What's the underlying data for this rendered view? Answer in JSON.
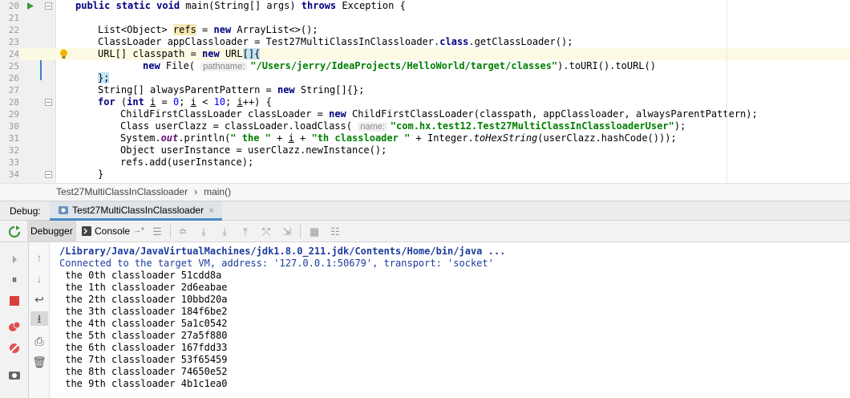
{
  "editor": {
    "line_numbers": [
      "20",
      "21",
      "22",
      "23",
      "24",
      "25",
      "26",
      "27",
      "28",
      "29",
      "30",
      "31",
      "32",
      "33",
      "34"
    ],
    "lines": {
      "l20": {
        "kw1": "public static void ",
        "rest": "main(String[] args) ",
        "kw2": "throws ",
        "rest2": "Exception {"
      },
      "l22": {
        "a": "List<Object> ",
        "refs": "refs",
        "b": " = ",
        "kw": "new ",
        "c": "ArrayList<>();"
      },
      "l23": {
        "a": "ClassLoader appClassloader = Test27MultiClassInClassloader.",
        "kw": "class",
        "b": ".getClassLoader();"
      },
      "l24": {
        "a": "URL[] classpath = ",
        "kw": "new ",
        "b": "URL",
        "brk": "[]{"
      },
      "l25": {
        "kw": "new ",
        "a": "File( ",
        "hint": "pathname:",
        "str": "\"/Users/jerry/IdeaProjects/HelloWorld/target/classes\"",
        "b": ").toURI().toURL()"
      },
      "l26": {
        "brk": "};"
      },
      "l27": {
        "a": "String[] alwaysParentPattern = ",
        "kw": "new ",
        "b": "String[]{};"
      },
      "l28": {
        "kw1": "for ",
        "a": "(",
        "kw2": "int ",
        "i1": "i",
        "b": " = ",
        "n0": "0",
        "c": "; ",
        "i2": "i",
        "d": " < ",
        "n10": "10",
        "e": "; ",
        "i3": "i",
        "f": "++) {"
      },
      "l29": {
        "a": "ChildFirstClassLoader classLoader = ",
        "kw": "new ",
        "b": "ChildFirstClassLoader(classpath, appClassloader, alwaysParentPattern);"
      },
      "l30": {
        "a": "Class userClazz = classLoader.loadClass( ",
        "hint": "name:",
        "str": "\"com.hx.test12.Test27MultiClassInClassloaderUser\"",
        "b": ");"
      },
      "l31": {
        "a": "System.",
        "out": "out",
        "b": ".println(",
        "s1": "\" the \"",
        "c": " + ",
        "i": "i",
        "d": " + ",
        "s2": "\"th classloader \"",
        "e": " + Integer.",
        "hex": "toHexString",
        "f": "(userClazz.hashCode()));"
      },
      "l32": {
        "a": "Object userInstance = userClazz.newInstance();"
      },
      "l33": {
        "a": "refs.add(userInstance);"
      },
      "l34": {
        "a": "}"
      }
    }
  },
  "breadcrumb": {
    "class": "Test27MultiClassInClassloader",
    "sep": "›",
    "method": "main()"
  },
  "debug": {
    "label": "Debug:",
    "tab_title": "Test27MultiClassInClassloader",
    "close": "×"
  },
  "toolbar": {
    "debugger": "Debugger",
    "console": "Console",
    "console_suffix": "→*"
  },
  "console": {
    "lines": [
      "/Library/Java/JavaVirtualMachines/jdk1.8.0_211.jdk/Contents/Home/bin/java ...",
      "Connected to the target VM, address: '127.0.0.1:50679', transport: 'socket'",
      " the 0th classloader 51cdd8a",
      " the 1th classloader 2d6eabae",
      " the 2th classloader 10bbd20a",
      " the 3th classloader 184f6be2",
      " the 4th classloader 5a1c0542",
      " the 5th classloader 27a5f880",
      " the 6th classloader 167fdd33",
      " the 7th classloader 53f65459",
      " the 8th classloader 74650e52",
      " the 9th classloader 4b1c1ea0"
    ]
  },
  "colors": {
    "keyword": "#000080",
    "string": "#008000",
    "field": "#660e7a",
    "console_info": "#1c3b9e",
    "accent": "#4a88c7"
  },
  "icons": [
    "run-gutter-icon",
    "bulb-icon",
    "rerun-icon",
    "resume-icon",
    "pause-icon",
    "stop-icon",
    "view-breakpoints-icon",
    "mute-breakpoints-icon",
    "camera-icon",
    "up-arrow-icon",
    "down-arrow-icon",
    "soft-wrap-icon",
    "scroll-to-end-icon",
    "print-icon",
    "trash-icon",
    "console-icon",
    "menu-icon",
    "step-over-icon",
    "step-into-icon",
    "force-step-into-icon",
    "step-out-icon",
    "drop-frame-icon",
    "run-to-cursor-icon",
    "evaluate-icon",
    "trace-icon"
  ]
}
